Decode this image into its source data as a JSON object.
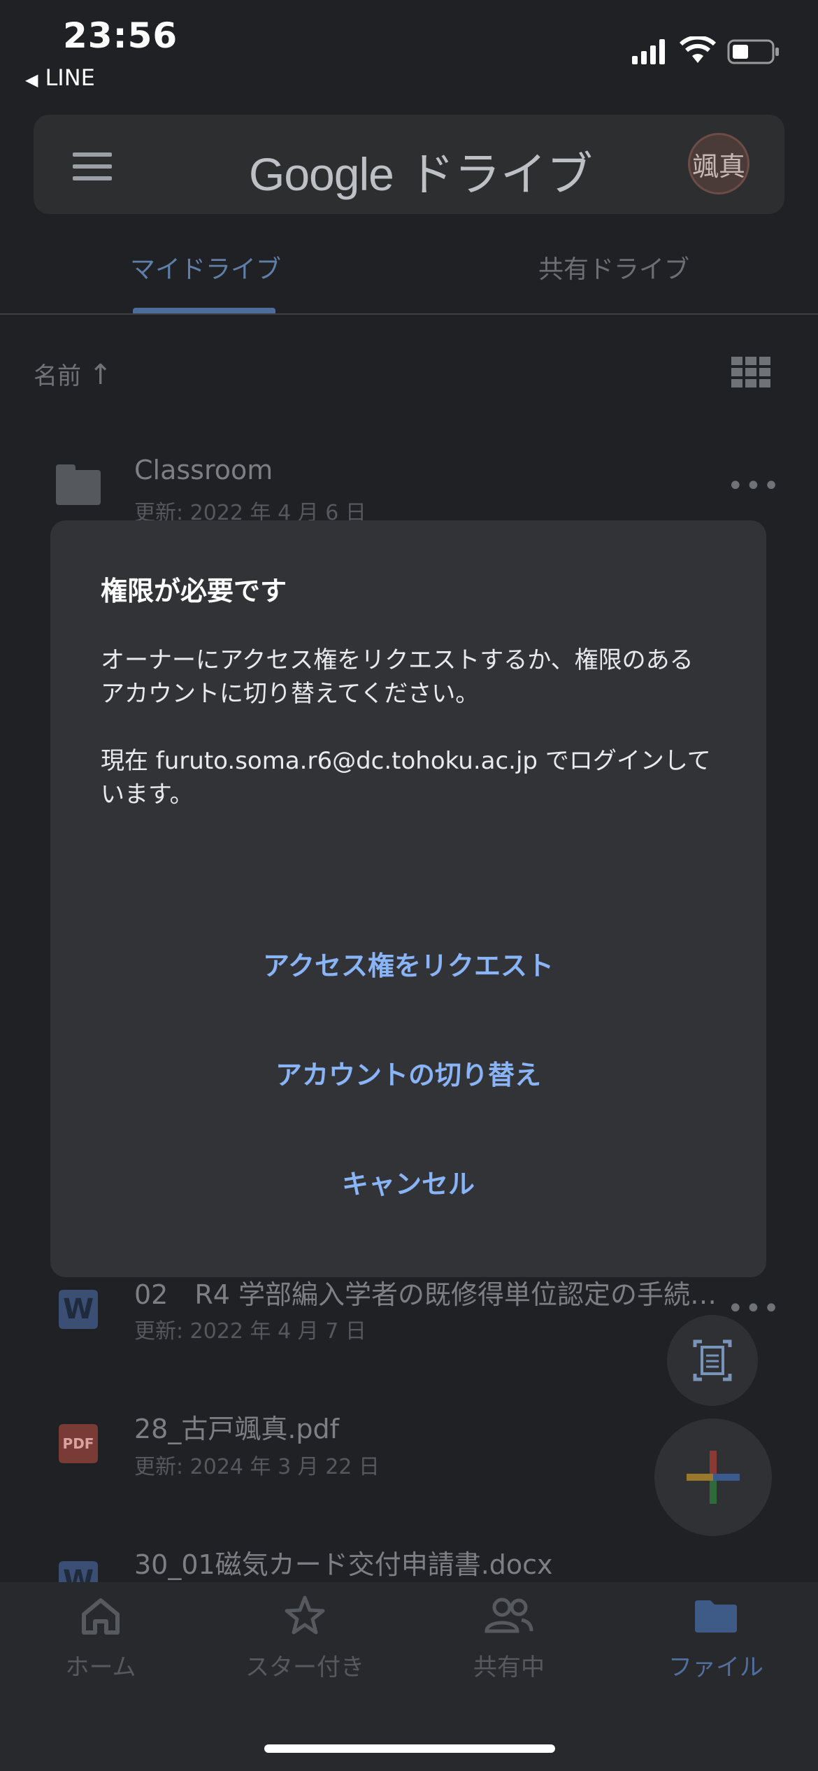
{
  "status_bar": {
    "time": "23:56",
    "back_app": "LINE"
  },
  "header": {
    "logo_google": "Google",
    "logo_drive": " ドライブ",
    "avatar_text": "颯真"
  },
  "tabs": [
    {
      "label": "マイドライブ"
    },
    {
      "label": "共有ドライブ"
    }
  ],
  "sort": {
    "label": "名前",
    "arrow": "↑"
  },
  "files": [
    {
      "name": "Classroom",
      "date": "更新: 2022 年 4 月 6 日",
      "icon": "folder-icon"
    },
    {
      "name": "02　R4 学部編入学者の既修得単位認定の手続…",
      "date": "更新: 2022 年 4 月 7 日",
      "icon": "word-icon",
      "icon_text": "W"
    },
    {
      "name": "28_古戸颯真.pdf",
      "date": "更新: 2024 年 3 月 22 日",
      "icon": "pdf-icon",
      "icon_text": "PDF"
    },
    {
      "name": "30_01磁気カード交付申請書.docx",
      "date": "",
      "icon": "word-icon",
      "icon_text": "W"
    }
  ],
  "dialog": {
    "title": "権限が必要です",
    "message1": "オーナーにアクセス権をリクエストするか、権限のあるアカウントに切り替えてください。",
    "message2": "現在 furuto.soma.r6@dc.tohoku.ac.jp でログインしています。",
    "request_button": "アクセス権をリクエスト",
    "switch_button": "アカウントの切り替え",
    "cancel_button": "キャンセル"
  },
  "bottom_nav": [
    {
      "label": "ホーム",
      "icon": "home-icon"
    },
    {
      "label": "スター付き",
      "icon": "star-icon"
    },
    {
      "label": "共有中",
      "icon": "shared-icon"
    },
    {
      "label": "ファイル",
      "icon": "folder-icon"
    }
  ],
  "colors": {
    "accent": "#8ab4f8",
    "background": "#202124",
    "dialog": "#323336"
  }
}
